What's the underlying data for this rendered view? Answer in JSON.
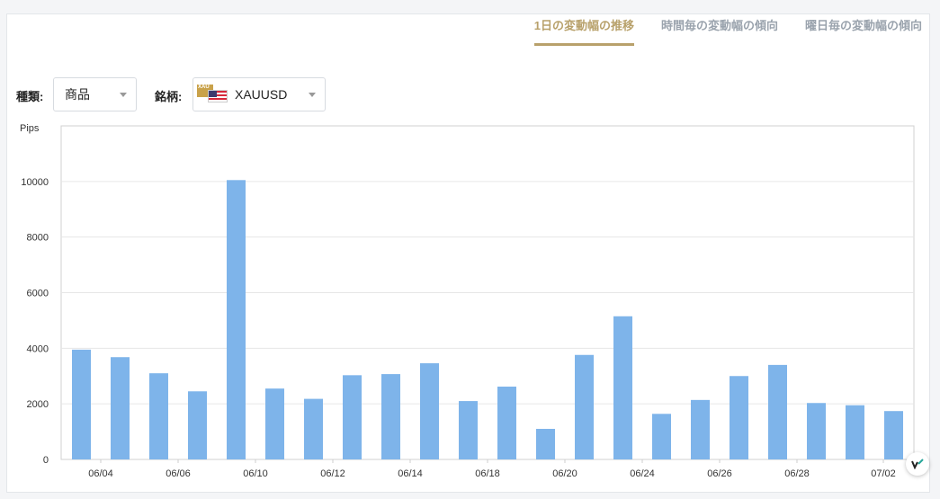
{
  "tabs": [
    {
      "label": "1日の変動幅の推移",
      "active": true
    },
    {
      "label": "時間毎の変動幅の傾向",
      "active": false
    },
    {
      "label": "曜日毎の変動幅の傾向",
      "active": false
    }
  ],
  "filters": {
    "type_label": "種類:",
    "type_value": "商品",
    "symbol_label": "銘柄:",
    "symbol_value": "XAUUSD",
    "symbol_flag_text": "XAU"
  },
  "colors": {
    "bar": "#7eb4ea",
    "accent": "#b8a16b",
    "grid": "#e6e6e6"
  },
  "chart_data": {
    "type": "bar",
    "ylabel": "Pips",
    "ylim": [
      0,
      12000
    ],
    "yticks": [
      0,
      2000,
      4000,
      6000,
      8000,
      10000
    ],
    "grid": true,
    "x_tick_labels": [
      "06/04",
      "06/06",
      "06/10",
      "06/12",
      "06/14",
      "06/18",
      "06/20",
      "06/24",
      "06/26",
      "06/28",
      "07/02"
    ],
    "values": [
      3950,
      3680,
      3100,
      2450,
      10050,
      2550,
      2180,
      3030,
      3070,
      3460,
      2100,
      2620,
      1100,
      3760,
      5150,
      1640,
      2140,
      3000,
      3400,
      2030,
      1950,
      1740
    ]
  }
}
